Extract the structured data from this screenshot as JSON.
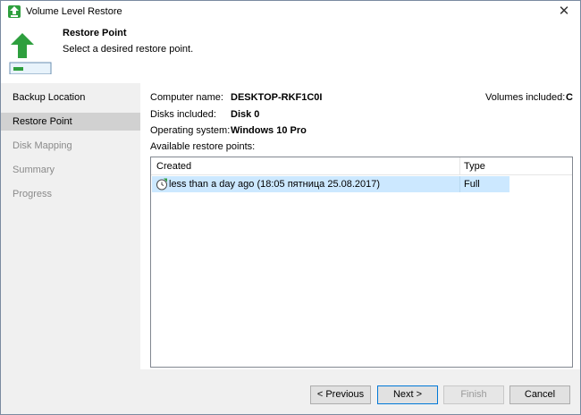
{
  "window": {
    "title": "Volume Level Restore",
    "close_glyph": "✕"
  },
  "header": {
    "title": "Restore Point",
    "subtitle": "Select a desired restore point.",
    "accent_color": "#2e9f3e"
  },
  "sidebar": {
    "items": [
      {
        "label": "Backup Location",
        "state": "done"
      },
      {
        "label": "Restore Point",
        "state": "active"
      },
      {
        "label": "Disk Mapping",
        "state": "pending"
      },
      {
        "label": "Summary",
        "state": "pending"
      },
      {
        "label": "Progress",
        "state": "pending"
      }
    ]
  },
  "info": {
    "computer_label": "Computer name:",
    "computer_value": "DESKTOP-RKF1C0I",
    "volumes_label": "Volumes included:",
    "volumes_value": "C",
    "disks_label": "Disks included:",
    "disks_value": "Disk 0",
    "os_label": "Operating system:",
    "os_value": "Windows 10 Pro",
    "restore_points_label": "Available restore points:"
  },
  "table": {
    "columns": [
      "Created",
      "Type"
    ],
    "rows": [
      {
        "created": "less than a day ago (18:05 пятница 25.08.2017)",
        "type": "Full",
        "selected": true,
        "icon": "restore-point-clock-icon"
      }
    ]
  },
  "footer": {
    "previous_label": "< Previous",
    "next_label": "Next >",
    "finish_label": "Finish",
    "cancel_label": "Cancel"
  }
}
